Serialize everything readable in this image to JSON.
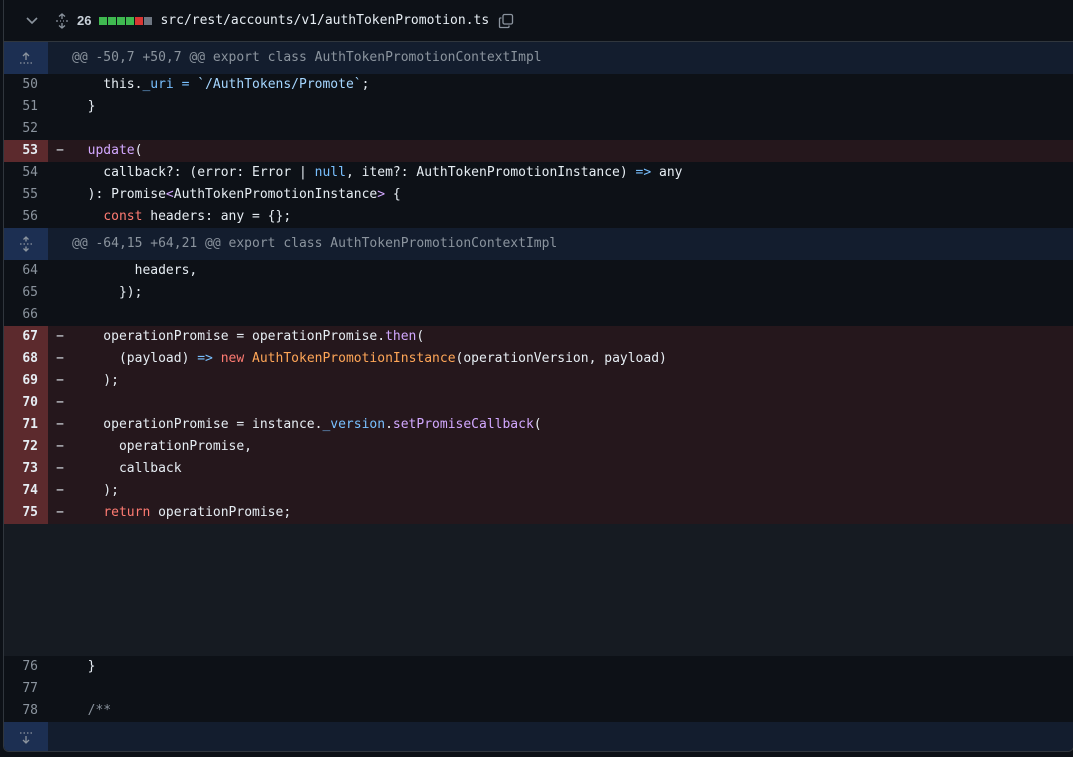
{
  "file": {
    "changes": "26",
    "path": "src/rest/accounts/v1/authTokenPromotion.ts",
    "blocks": [
      "#3fb950",
      "#3fb950",
      "#3fb950",
      "#3fb950",
      "#da3633",
      "#6e7681"
    ]
  },
  "hunks": [
    {
      "header": "@@ -50,7 +50,7 @@ export class AuthTokenPromotionContextImpl"
    },
    {
      "header": "@@ -64,15 +64,21 @@ export class AuthTokenPromotionContextImpl"
    }
  ],
  "lines": {
    "l50": {
      "num": "50",
      "marker": "",
      "a": "    this.",
      "b": "_uri",
      "c": " = ",
      "d": "`/AuthTokens/Promote`",
      "e": ";"
    },
    "l51": {
      "num": "51",
      "marker": "",
      "text": "  }"
    },
    "l52": {
      "num": "52",
      "marker": "",
      "text": ""
    },
    "l53": {
      "num": "53",
      "marker": "−",
      "fn": "update",
      "rest": "("
    },
    "l54": {
      "num": "54",
      "marker": "",
      "a": "    callback?: (error: Error | ",
      "b": "null",
      "c": ", item?: AuthTokenPromotionInstance) ",
      "d": "=>",
      "e": " any"
    },
    "l55": {
      "num": "55",
      "marker": "",
      "a": "  ): Promise",
      "b": "<",
      "c": "AuthTokenPromotionInstance",
      "d": ">",
      "e": " {"
    },
    "l56": {
      "num": "56",
      "marker": "",
      "kw": "const",
      "rest": " headers: any = {};"
    },
    "l64": {
      "num": "64",
      "marker": "",
      "text": "        headers,"
    },
    "l65": {
      "num": "65",
      "marker": "",
      "text": "      });"
    },
    "l66": {
      "num": "66",
      "marker": "",
      "text": ""
    },
    "l67": {
      "num": "67",
      "marker": "−",
      "a": "    operationPromise = operationPromise.",
      "b": "then",
      "c": "("
    },
    "l68": {
      "num": "68",
      "marker": "−",
      "a": "      (payload) ",
      "b": "=>",
      "c": " ",
      "d": "new",
      "e": " ",
      "f": "AuthTokenPromotionInstance",
      "g": "(operationVersion, payload)"
    },
    "l69": {
      "num": "69",
      "marker": "−",
      "text": "    );"
    },
    "l70": {
      "num": "70",
      "marker": "−",
      "text": ""
    },
    "l71": {
      "num": "71",
      "marker": "−",
      "a": "    operationPromise = instance.",
      "b": "_version",
      "c": ".",
      "d": "setPromiseCallback",
      "e": "("
    },
    "l72": {
      "num": "72",
      "marker": "−",
      "text": "      operationPromise,"
    },
    "l73": {
      "num": "73",
      "marker": "−",
      "text": "      callback"
    },
    "l74": {
      "num": "74",
      "marker": "−",
      "text": "    );"
    },
    "l75": {
      "num": "75",
      "marker": "−",
      "kw": "return",
      "rest": " operationPromise;"
    },
    "l76": {
      "num": "76",
      "marker": "",
      "text": "  }"
    },
    "l77": {
      "num": "77",
      "marker": "",
      "text": ""
    },
    "l78": {
      "num": "78",
      "marker": "",
      "text": "  /**"
    }
  }
}
